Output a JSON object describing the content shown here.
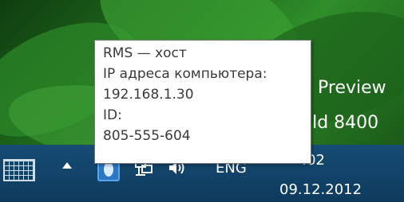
{
  "desktop": {
    "watermark_line1": "Preview",
    "watermark_line2": "ild 8400"
  },
  "taskbar": {
    "touch_keyboard_icon": "keyboard-icon",
    "show_hidden_icons": "chevron-up-icon",
    "language": "ENG",
    "time": ":02",
    "date": "09.12.2012"
  },
  "tooltip": {
    "title": "RMS — хост",
    "ip_label": "IP адреса компьютера:",
    "ip_value": "192.168.1.30",
    "id_label": "ID:",
    "id_value": "805-555-604"
  },
  "colors": {
    "taskbar": "#174c74",
    "tooltip_bg": "#ffffff",
    "tooltip_text": "#3a3a3a"
  }
}
